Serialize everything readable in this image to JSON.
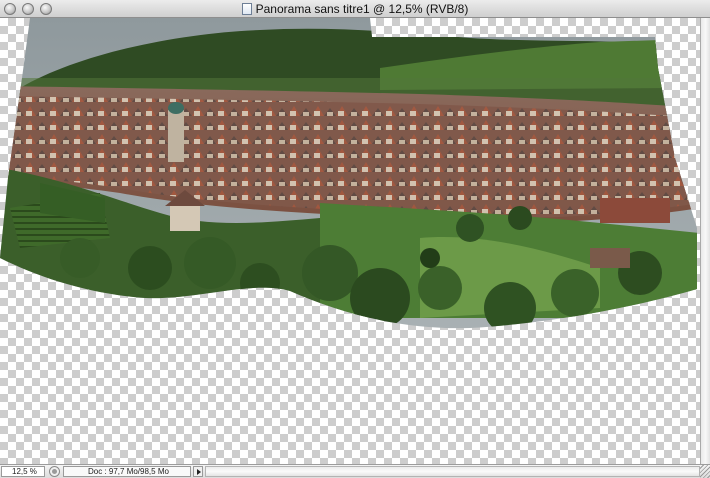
{
  "window": {
    "title": "Panorama sans titre1 @ 12,5% (RVB/8)",
    "controls": [
      "close-button",
      "minimize-button",
      "zoom-button"
    ]
  },
  "status_bar": {
    "zoom": "12,5 %",
    "doc_info": "Doc : 97,7 Mo/98,5 Mo"
  },
  "canvas": {
    "background": "transparency-checkerboard",
    "image_subject": "panorama",
    "colors": {
      "sky": "#9aa3a7",
      "forest": "#2e4a22",
      "roofs": "#8c4a38",
      "meadow": "#5d8a3a"
    }
  }
}
